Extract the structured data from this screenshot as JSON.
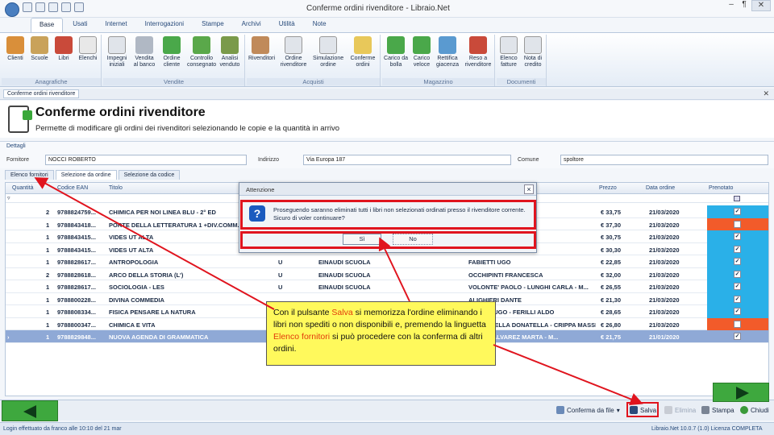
{
  "window": {
    "title": "Conferme ordini rivenditore - Libraio.Net",
    "minimize": "–",
    "restore": "¶",
    "close": "✕"
  },
  "ribbon_tabs": [
    "Base",
    "Usati",
    "Internet",
    "Interrogazioni",
    "Stampe",
    "Archivi",
    "Utilità",
    "Note"
  ],
  "ribbon_groups": [
    {
      "label": "Anagrafiche",
      "buttons": [
        "Clienti",
        "Scuole",
        "Libri",
        "Elenchi"
      ]
    },
    {
      "label": "Vendite",
      "buttons": [
        "Impegni iniziali",
        "Vendita al banco",
        "Ordine cliente",
        "Controllo consegnato",
        "Analisi venduto"
      ]
    },
    {
      "label": "Acquisti",
      "buttons": [
        "Rivenditori",
        "Ordine rivenditore",
        "Simulazione ordine",
        "Conferme ordini"
      ]
    },
    {
      "label": "Magazzino",
      "buttons": [
        "Carico da bolla",
        "Carico veloce",
        "Rettifica giacenza",
        "Reso a rivenditore"
      ]
    },
    {
      "label": "Documenti",
      "buttons": [
        "Elenco fatture",
        "Nota di credito"
      ]
    }
  ],
  "doc_tab": {
    "label": "Conferme ordini rivenditore",
    "close": "✕"
  },
  "header": {
    "title": "Conferme ordini rivenditore",
    "subtitle": "Permette di modificare gli ordini dei rivenditori selezionando le copie e la quantità in arrivo"
  },
  "filters": {
    "section": "Dettagli",
    "fornitore_label": "Fornitore",
    "fornitore_value": "NOCCI ROBERTO",
    "indirizzo_label": "Indirizzo",
    "indirizzo_value": "Via Europa 187",
    "comune_label": "Comune",
    "comune_value": "spoltore"
  },
  "sub_tabs": [
    "Elenco fornitori",
    "Selezione da ordine",
    "Selezione da codice"
  ],
  "grid": {
    "columns": [
      "Quantità",
      "Codice EAN",
      "Titolo",
      "Prezzo",
      "Data ordine",
      "Prenotato"
    ],
    "rows": [
      {
        "qty": "2",
        "ean": "9788824759...",
        "title": "CHIMICA PER NOI LINEA BLU - 2° ED",
        "col4": "",
        "col5": "",
        "author": "EGREZZA AURO...",
        "price": "€ 33,75",
        "date": "21/03/2020",
        "pren": "on",
        "check": "✓"
      },
      {
        "qty": "1",
        "ean": "9788843418...",
        "title": "PORTE DELLA LETTERATURA 1 +DIV.COMM.",
        "col4": "",
        "col5": "",
        "author": "",
        "price": "€ 37,30",
        "date": "21/03/2020",
        "pren": "off",
        "check": ""
      },
      {
        "qty": "1",
        "ean": "9788843415...",
        "title": "VIDES UT ALTA",
        "col4": "",
        "col5": "",
        "author": "",
        "price": "€ 30,75",
        "date": "21/03/2020",
        "pren": "on",
        "check": "✓"
      },
      {
        "qty": "1",
        "ean": "9788843415...",
        "title": "VIDES UT ALTA",
        "col4": "",
        "col5": "",
        "author": "",
        "price": "€ 30,30",
        "date": "21/03/2020",
        "pren": "on",
        "check": "✓"
      },
      {
        "qty": "1",
        "ean": "9788828617...",
        "title": "ANTROPOLOGIA",
        "col4": "U",
        "col5": "EINAUDI SCUOLA",
        "author": "FABIETTI UGO",
        "price": "€ 22,85",
        "date": "21/03/2020",
        "pren": "on",
        "check": "✓"
      },
      {
        "qty": "2",
        "ean": "9788828618...",
        "title": "ARCO DELLA STORIA (L')",
        "col4": "U",
        "col5": "EINAUDI SCUOLA",
        "author": "OCCHIPINTI FRANCESCA",
        "price": "€ 32,00",
        "date": "21/03/2020",
        "pren": "on",
        "check": "✓"
      },
      {
        "qty": "1",
        "ean": "9788828617...",
        "title": "SOCIOLOGIA - LES",
        "col4": "U",
        "col5": "EINAUDI SCUOLA",
        "author": "VOLONTE' PAOLO - LUNGHI CARLA - M...",
        "price": "€ 26,55",
        "date": "21/03/2020",
        "pren": "on",
        "check": "✓"
      },
      {
        "qty": "1",
        "ean": "9788800228...",
        "title": "DIVINA COMMEDIA",
        "col4": "",
        "col5": "",
        "author": "ALIGHIERI DANTE",
        "price": "€ 21,30",
        "date": "21/03/2020",
        "pren": "on",
        "check": "✓"
      },
      {
        "qty": "1",
        "ean": "9788808334...",
        "title": "FISICA PENSARE LA NATURA",
        "col4": "",
        "col5": "",
        "author": "AMALDI UGO - FERILLI ALDO",
        "price": "€ 28,65",
        "date": "21/03/2020",
        "pren": "on",
        "check": "✓"
      },
      {
        "qty": "1",
        "ean": "9788800347...",
        "title": "CHIMICA E VITA",
        "col4": "",
        "col5": "",
        "author": "CAMPANELLA DONATELLA - CRIPPA MASSI...",
        "price": "€ 26,80",
        "date": "21/03/2020",
        "pren": "off",
        "check": ""
      },
      {
        "qty": "1",
        "ean": "9788829848...",
        "title": "NUOVA AGENDA DI GRAMMATICA",
        "col4": "",
        "col5": "",
        "author": "SILVIA - ALVAREZ MARTA - M...",
        "price": "€ 21,75",
        "date": "21/01/2020",
        "pren": "sel",
        "check": "✓"
      }
    ]
  },
  "dialog": {
    "title": "Attenzione",
    "message": "Proseguendo saranno eliminati tutti i libri non selezionati ordinati presso il rivenditore corrente. Sicuro di voler continuare?",
    "yes": "Sì",
    "no": "No"
  },
  "callout": {
    "part1": "Con il pulsante ",
    "salva": "Salva",
    "part2": " si memorizza l'ordine eliminando i libri non spediti o non disponibili e, premendo la linguetta ",
    "elenco": "Elenco fornitori",
    "part3": " si può procedere con la conferma di altri ordini."
  },
  "bottom": {
    "conferma": "Conferma da file",
    "salva": "Salva",
    "elimina": "Elimina",
    "stampa": "Stampa",
    "chiudi": "Chiudi"
  },
  "status": {
    "left": "Login effettuato da franco alle 10:10 del 21 mar",
    "right": "Libraio.Net 10.0.7 (1.0) Licenza COMPLETA"
  },
  "colors": {
    "prenotato_on": "#2ab0e8",
    "prenotato_off": "#f25b2a",
    "highlight_red": "#e0141e",
    "callout_bg": "#fff95c"
  }
}
